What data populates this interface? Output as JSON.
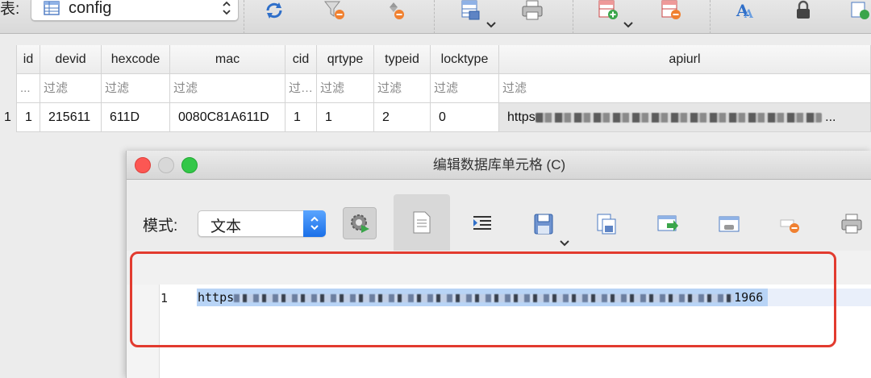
{
  "toolbar": {
    "table_label": "表:",
    "table_name": "config"
  },
  "grid": {
    "columns": [
      "id",
      "devid",
      "hexcode",
      "mac",
      "cid",
      "qrtype",
      "typeid",
      "locktype",
      "apiurl"
    ],
    "filters": [
      "...",
      "过滤",
      "过滤",
      "过滤",
      "过…",
      "过滤",
      "过滤",
      "过滤",
      "过滤"
    ],
    "rows": [
      {
        "row_number": "1",
        "cells": [
          "1",
          "215611",
          "611D",
          "0080C81A611D",
          "1",
          "1",
          "2",
          "0"
        ],
        "apiurl_prefix": "https",
        "apiurl_suffix": "..."
      }
    ]
  },
  "dialog": {
    "title": "编辑数据库单元格 (C)",
    "mode_label": "模式:",
    "mode_value": "文本",
    "editor": {
      "line_number": "1",
      "text_prefix": "https",
      "text_suffix": "1966"
    }
  },
  "icons": {
    "toolbar": [
      "refresh-icon",
      "filter-clear-icon",
      "sort-icon",
      "save-table-icon",
      "print-icon",
      "insert-record-icon",
      "delete-record-icon",
      "font-icon",
      "lock-icon"
    ],
    "dialog": [
      "gear-icon",
      "document-icon",
      "indent-icon",
      "save-icon",
      "copy-icon",
      "export-icon",
      "image-icon",
      "clear-icon",
      "print-icon"
    ]
  },
  "colors": {
    "accent": "#1a6fe8",
    "highlight_box": "#e23b2f",
    "selection": "#b8d4f6"
  }
}
